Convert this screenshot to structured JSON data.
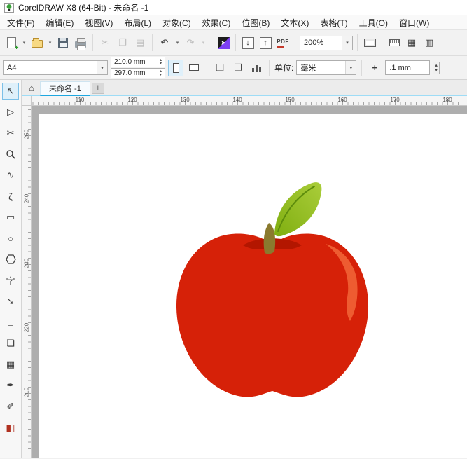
{
  "window": {
    "title": "CorelDRAW X8 (64-Bit) - 未命名 -1"
  },
  "menu": {
    "items": [
      "文件(F)",
      "编辑(E)",
      "视图(V)",
      "布局(L)",
      "对象(C)",
      "效果(C)",
      "位图(B)",
      "文本(X)",
      "表格(T)",
      "工具(O)",
      "窗口(W)"
    ]
  },
  "toolbar": {
    "dropdown_glyph": "▾",
    "cut_glyph": "✂",
    "copy_glyph": "❐",
    "paste_glyph": "▤",
    "undo_glyph": "↶",
    "redo_glyph": "↷",
    "launcher_glyph": "➤",
    "import_glyph": "↓",
    "export_glyph": "↑",
    "pdf_label": "PDF",
    "zoom_level": "200%",
    "grid_glyph": "▦",
    "grid_options_glyph": "▥"
  },
  "property_bar": {
    "page_size": "A4",
    "width_value": "210.0 mm",
    "height_value": "297.0 mm",
    "spin_up": "▴",
    "spin_down": "▾",
    "single_page_glyph": "❏",
    "facing_pages_glyph": "❐",
    "units_label": "单位:",
    "units_value": "毫米",
    "nudge_glyph": "+",
    "nudge_value": ".1 mm"
  },
  "tabs": {
    "home_glyph": "⌂",
    "active": "未命名 -1",
    "new_tab": "+"
  },
  "rulers": {
    "horizontal": [
      "110",
      "120",
      "130",
      "140",
      "150",
      "160",
      "170",
      "180"
    ],
    "vertical": [
      "250",
      "240",
      "230",
      "220",
      "210"
    ]
  },
  "toolbox": {
    "tools": [
      {
        "name": "pick-tool",
        "glyph": "↖",
        "selected": true
      },
      {
        "name": "shape-tool",
        "glyph": "▷"
      },
      {
        "name": "crop-tool",
        "glyph": "✂"
      },
      {
        "name": "zoom-tool",
        "glyph": ""
      },
      {
        "name": "freehand-tool",
        "glyph": "∿"
      },
      {
        "name": "bezier-tool",
        "glyph": "ζ"
      },
      {
        "name": "rectangle-tool",
        "glyph": "▭"
      },
      {
        "name": "ellipse-tool",
        "glyph": "○"
      },
      {
        "name": "polygon-tool",
        "glyph": ""
      },
      {
        "name": "text-tool",
        "glyph": "字"
      },
      {
        "name": "dimension-tool",
        "glyph": "↘"
      },
      {
        "name": "connector-tool",
        "glyph": "∟"
      },
      {
        "name": "drop-shadow-tool",
        "glyph": "❏"
      },
      {
        "name": "transparency-tool",
        "glyph": "▦"
      },
      {
        "name": "eyedropper-tool",
        "glyph": "✒"
      },
      {
        "name": "outline-pen-tool",
        "glyph": "✐"
      },
      {
        "name": "fill-tool",
        "glyph": "◧"
      }
    ]
  },
  "colors": {
    "accent_blue": "#1ea7e0",
    "tab_underline": "#9edcf6",
    "launcher_purple": "#7d3ff2"
  },
  "apple": {
    "body_color": "#d62108",
    "shadow_color": "#b31600",
    "highlight_color": "#ee5c31",
    "leaf_light": "#aacd3a",
    "leaf_dark": "#7fae10",
    "vein_color": "#5d8c0c",
    "stem_color": "#8a7a2e"
  }
}
